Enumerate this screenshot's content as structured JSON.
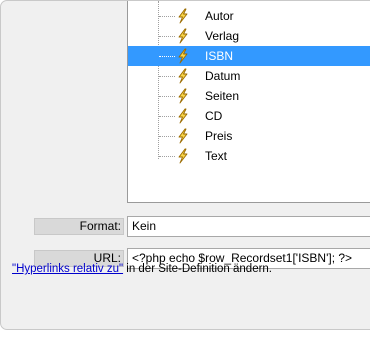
{
  "tree": {
    "items": [
      {
        "label": "Autor",
        "selected": false
      },
      {
        "label": "Verlag",
        "selected": false
      },
      {
        "label": "ISBN",
        "selected": true
      },
      {
        "label": "Datum",
        "selected": false
      },
      {
        "label": "Seiten",
        "selected": false
      },
      {
        "label": "CD",
        "selected": false
      },
      {
        "label": "Preis",
        "selected": false
      },
      {
        "label": "Text",
        "selected": false
      }
    ],
    "item_icon": "lightning-bolt-icon",
    "selection_color": "#3399ff"
  },
  "format": {
    "label": "Format:",
    "value": "Kein"
  },
  "url": {
    "label": "URL:",
    "value": "<?php echo $row_Recordset1['ISBN']; ?>"
  },
  "hint": {
    "link_text": "\"Hyperlinks relativ zu\"",
    "text": " in der Site-Definition ändern."
  }
}
